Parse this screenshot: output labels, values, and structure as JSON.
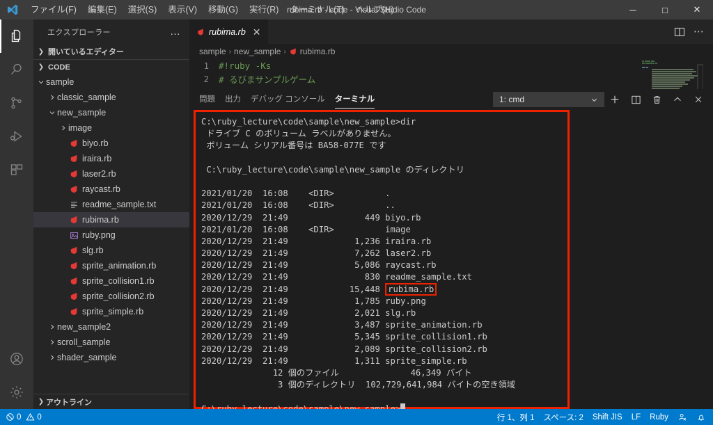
{
  "window": {
    "title": "rubima.rb - code - Visual Studio Code",
    "minimize_label": "─",
    "maximize_label": "□",
    "close_label": "✕"
  },
  "menu": {
    "items": [
      {
        "label": "ファイル(F)"
      },
      {
        "label": "編集(E)"
      },
      {
        "label": "選択(S)"
      },
      {
        "label": "表示(V)"
      },
      {
        "label": "移動(G)"
      },
      {
        "label": "実行(R)"
      },
      {
        "label": "ターミナル(T)"
      },
      {
        "label": "ヘルプ(H)"
      }
    ]
  },
  "activitybar": {
    "items": [
      {
        "name": "explorer-icon",
        "active": true
      },
      {
        "name": "search-icon",
        "active": false
      },
      {
        "name": "source-control-icon",
        "active": false
      },
      {
        "name": "run-debug-icon",
        "active": false
      },
      {
        "name": "extensions-icon",
        "active": false
      }
    ],
    "bottom": [
      {
        "name": "accounts-icon"
      },
      {
        "name": "settings-gear-icon"
      }
    ]
  },
  "sidebar": {
    "title": "エクスプローラー",
    "more_actions": "…",
    "open_editors_label": "開いているエディター",
    "root_label": "CODE",
    "outline_label": "アウトライン",
    "tree": [
      {
        "label": "sample",
        "depth": 1,
        "type": "folder",
        "expanded": true,
        "selected": false
      },
      {
        "label": "classic_sample",
        "depth": 2,
        "type": "folder",
        "expanded": false,
        "selected": false
      },
      {
        "label": "new_sample",
        "depth": 2,
        "type": "folder",
        "expanded": true,
        "selected": false
      },
      {
        "label": "image",
        "depth": 3,
        "type": "folder",
        "expanded": false,
        "selected": false
      },
      {
        "label": "biyo.rb",
        "depth": 3,
        "type": "ruby",
        "selected": false
      },
      {
        "label": "iraira.rb",
        "depth": 3,
        "type": "ruby",
        "selected": false
      },
      {
        "label": "laser2.rb",
        "depth": 3,
        "type": "ruby",
        "selected": false
      },
      {
        "label": "raycast.rb",
        "depth": 3,
        "type": "ruby",
        "selected": false
      },
      {
        "label": "readme_sample.txt",
        "depth": 3,
        "type": "text",
        "selected": false
      },
      {
        "label": "rubima.rb",
        "depth": 3,
        "type": "ruby",
        "selected": true
      },
      {
        "label": "ruby.png",
        "depth": 3,
        "type": "image",
        "selected": false
      },
      {
        "label": "slg.rb",
        "depth": 3,
        "type": "ruby",
        "selected": false
      },
      {
        "label": "sprite_animation.rb",
        "depth": 3,
        "type": "ruby",
        "selected": false
      },
      {
        "label": "sprite_collision1.rb",
        "depth": 3,
        "type": "ruby",
        "selected": false
      },
      {
        "label": "sprite_collision2.rb",
        "depth": 3,
        "type": "ruby",
        "selected": false
      },
      {
        "label": "sprite_simple.rb",
        "depth": 3,
        "type": "ruby",
        "selected": false
      },
      {
        "label": "new_sample2",
        "depth": 2,
        "type": "folder",
        "expanded": false,
        "selected": false
      },
      {
        "label": "scroll_sample",
        "depth": 2,
        "type": "folder",
        "expanded": false,
        "selected": false
      },
      {
        "label": "shader_sample",
        "depth": 2,
        "type": "folder",
        "expanded": false,
        "selected": false
      }
    ]
  },
  "editor": {
    "tab_label": "rubima.rb",
    "tab_close": "✕",
    "split_editor_title": "split-editor",
    "more_title": "more-actions",
    "breadcrumb": [
      "sample",
      "new_sample",
      "rubima.rb"
    ],
    "breadcrumb_sep": "›",
    "lines": [
      {
        "no": "1",
        "text": "#!ruby -Ks"
      },
      {
        "no": "2",
        "text": "# るびまサンプルゲーム"
      }
    ]
  },
  "panel": {
    "tabs": [
      {
        "label": "問題",
        "active": false
      },
      {
        "label": "出力",
        "active": false
      },
      {
        "label": "デバッグ コンソール",
        "active": false
      },
      {
        "label": "ターミナル",
        "active": true
      }
    ],
    "terminal_select": "1: cmd",
    "select_chevron": "⌄",
    "buttons": [
      {
        "name": "new-terminal-button",
        "glyph": "+"
      },
      {
        "name": "split-terminal-button",
        "glyph": "split"
      },
      {
        "name": "kill-terminal-button",
        "glyph": "trash"
      },
      {
        "name": "maximize-panel-button",
        "glyph": "^"
      },
      {
        "name": "close-panel-button",
        "glyph": "✕"
      }
    ]
  },
  "terminal": {
    "lines": [
      "C:\\ruby_lecture\\code\\sample\\new_sample>dir",
      " ドライブ C のボリューム ラベルがありません。",
      " ボリューム シリアル番号は BA58-077E です",
      "",
      " C:\\ruby_lecture\\code\\sample\\new_sample のディレクトリ",
      "",
      "2021/01/20  16:08    <DIR>          .",
      "2021/01/20  16:08    <DIR>          ..",
      "2020/12/29  21:49               449 biyo.rb",
      "2021/01/20  16:08    <DIR>          image",
      "2020/12/29  21:49             1,236 iraira.rb",
      "2020/12/29  21:49             7,262 laser2.rb",
      "2020/12/29  21:49             5,086 raycast.rb",
      "2020/12/29  21:49               830 readme_sample.txt"
    ],
    "highlighted_line": {
      "prefix": "2020/12/29  21:49            15,448 ",
      "highlight": "rubima.rb"
    },
    "lines_after": [
      "2020/12/29  21:49             1,785 ruby.png",
      "2020/12/29  21:49             2,021 slg.rb",
      "2020/12/29  21:49             3,487 sprite_animation.rb",
      "2020/12/29  21:49             5,345 sprite_collision1.rb",
      "2020/12/29  21:49             2,089 sprite_collision2.rb",
      "2020/12/29  21:49             1,311 sprite_simple.rb",
      "              12 個のファイル              46,349 バイト",
      "               3 個のディレクトリ  102,729,641,984 バイトの空き領域",
      ""
    ],
    "prompt": "C:\\ruby_lecture\\code\\sample\\new_sample>"
  },
  "statusbar": {
    "errors": "0",
    "warnings": "0",
    "cursor_position": "行 1、列 1",
    "indentation": "スペース: 2",
    "encoding": "Shift JIS",
    "eol": "LF",
    "language": "Ruby",
    "feedback_title": "tweet-feedback",
    "notifications_title": "notifications-bell"
  },
  "colors": {
    "accent": "#007acc",
    "highlight_red": "#ee2200",
    "ruby_icon": "#e53935",
    "titlebar_bg": "#3c3c3c",
    "sidebar_bg": "#252526",
    "editor_bg": "#1e1e1e"
  }
}
